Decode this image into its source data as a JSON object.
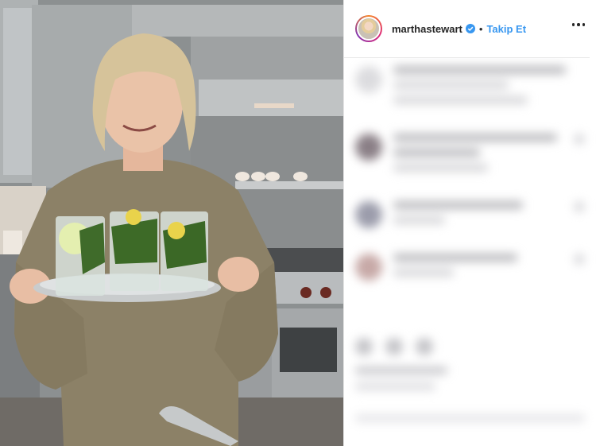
{
  "post": {
    "username": "marthastewart",
    "separator": "•",
    "follow_label": "Takip Et"
  },
  "icons": {
    "verified": "verified-badge-icon",
    "more": "more-options-icon"
  },
  "colors": {
    "link_blue": "#3897f0",
    "verified_blue": "#3897f0",
    "text_dark": "#262626"
  }
}
